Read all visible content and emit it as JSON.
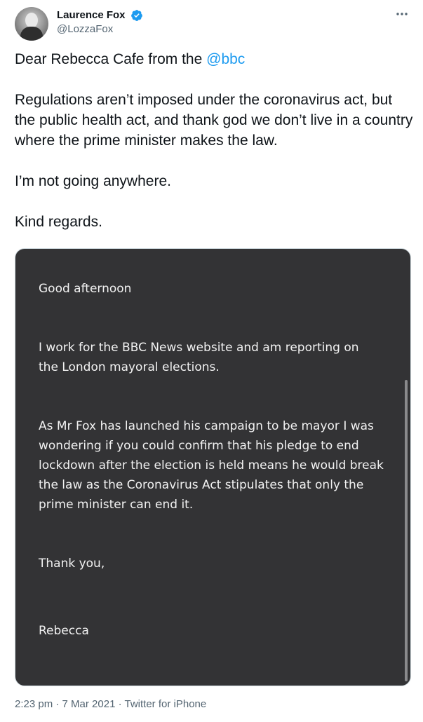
{
  "author": {
    "display_name": "Laurence Fox",
    "handle": "@LozzaFox",
    "verified": true,
    "avatar_icon": "profile-photo-icon"
  },
  "tweet": {
    "line1_prefix": "Dear Rebecca Cafe from the ",
    "line1_mention": "@bbc",
    "paragraph2": "Regulations aren’t imposed under the coronavirus act, but the public health act, and thank god we don’t live in a country where the prime minister makes the law.",
    "paragraph3": "I’m not going anywhere.",
    "paragraph4": "Kind regards."
  },
  "image_letter": {
    "greeting": "Good afternoon",
    "para1": "I work for the BBC News website and am reporting on the London mayoral elections.",
    "para2": "As Mr Fox has launched his campaign to be mayor I was wondering if you could confirm that his pledge to end lockdown after the election is held means he would break the law as the Coronavirus Act stipulates that only the prime minister can end it.",
    "closing": "Thank you,",
    "signature": "Rebecca"
  },
  "meta": {
    "time": "2:23 pm",
    "date": "7 Mar 2021",
    "source": "Twitter for iPhone",
    "separator": " · "
  },
  "colors": {
    "mention": "#1d9bf0",
    "verified": "#1d9bf0",
    "image_bg": "#333335"
  }
}
